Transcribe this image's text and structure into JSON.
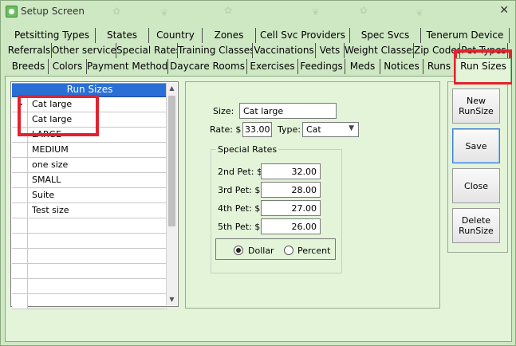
{
  "window": {
    "title": "Setup Screen",
    "close_symbol": "✕"
  },
  "tabs": {
    "row1": [
      "Petsitting Types",
      "States",
      "Country",
      "Zones",
      "Cell Svc Providers",
      "Spec Svcs",
      "Tenerum Device"
    ],
    "row2": [
      "Referrals",
      "Other services",
      "Special Rates",
      "Training Classes",
      "Vaccinations",
      "Vets",
      "Weight Classes",
      "Zip Codes",
      "Pet Types"
    ],
    "row3": [
      "Breeds",
      "Colors",
      "Payment Methods",
      "Daycare Rooms",
      "Exercises",
      "Feedings",
      "Meds",
      "Notices",
      "Runs",
      "Run Sizes"
    ],
    "active": "Run Sizes"
  },
  "grid": {
    "header": "Run Sizes",
    "rows": [
      "Cat large",
      "Cat large",
      "LARGE",
      "MEDIUM",
      "one size",
      "SMALL",
      "Suite",
      "Test size",
      "",
      "",
      "",
      "",
      "",
      ""
    ],
    "scroll_up": "▲",
    "scroll_down": "▼"
  },
  "detail": {
    "size_label": "Size:",
    "size_value": "Cat large",
    "rate_label": "Rate: $",
    "rate_value": "33.00",
    "type_label": "Type:",
    "type_value": "Cat",
    "special_rates_title": "Special Rates",
    "pet_rates": [
      {
        "label": "2nd Pet: $",
        "value": "32.00"
      },
      {
        "label": "3rd Pet: $",
        "value": "28.00"
      },
      {
        "label": "4th Pet: $",
        "value": "27.00"
      },
      {
        "label": "5th Pet: $",
        "value": "26.00"
      }
    ],
    "radio_dollar": "Dollar",
    "radio_percent": "Percent",
    "radio_selected": "Dollar"
  },
  "buttons": {
    "new": "New\nRunSize",
    "save": "Save",
    "close": "Close",
    "delete": "Delete\nRunSize"
  },
  "colors": {
    "accent_header": "#2a6fd6",
    "annotation": "#e0232f",
    "window_bg": "#cfe8c4",
    "panel_bg": "#e3f4d9"
  }
}
